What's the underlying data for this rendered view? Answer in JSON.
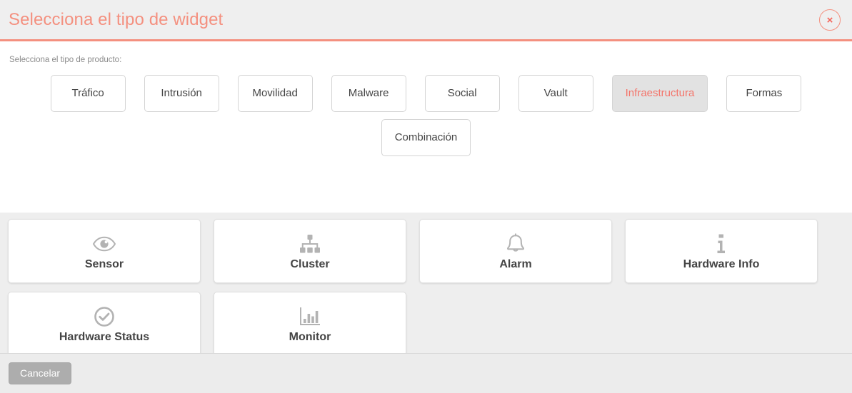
{
  "header": {
    "title": "Selecciona el tipo de widget",
    "close_label": "×",
    "accent_color": "#f4907f",
    "background_color": "#efefef"
  },
  "body": {
    "product_label": "Selecciona el tipo de producto:",
    "product_rows": [
      [
        {
          "label": "Tráfico",
          "active": false
        },
        {
          "label": "Intrusión",
          "active": false
        },
        {
          "label": "Movilidad",
          "active": false
        },
        {
          "label": "Malware",
          "active": false
        },
        {
          "label": "Social",
          "active": false
        },
        {
          "label": "Vault",
          "active": false
        },
        {
          "label": "Infraestructura",
          "active": true
        },
        {
          "label": "Formas",
          "active": false
        }
      ],
      [
        {
          "label": "Combinación",
          "active": false
        }
      ]
    ],
    "active_product": "Infraestructura",
    "active_text_color": "#f4746a",
    "active_background_color": "#e2e2e2"
  },
  "widgets": {
    "rows": [
      [
        {
          "label": "Sensor",
          "icon": "eye-icon"
        },
        {
          "label": "Cluster",
          "icon": "sitemap-icon"
        },
        {
          "label": "Alarm",
          "icon": "bell-icon"
        },
        {
          "label": "Hardware Info",
          "icon": "info-icon"
        }
      ],
      [
        {
          "label": "Hardware Status",
          "icon": "check-circle-icon"
        },
        {
          "label": "Monitor",
          "icon": "bar-chart-icon"
        }
      ]
    ],
    "icon_color": "#b3b3b3",
    "label_color": "#444444"
  },
  "footer": {
    "cancel_label": "Cancelar",
    "cancel_background_color": "#adadad"
  }
}
